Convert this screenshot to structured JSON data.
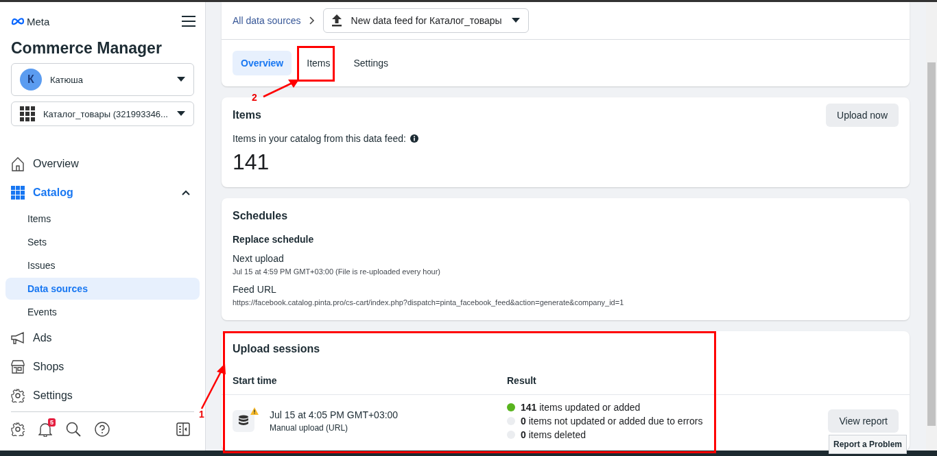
{
  "sidebar": {
    "brand": "Meta",
    "title": "Commerce Manager",
    "account": {
      "initial": "К",
      "name": "Катюша"
    },
    "catalog": "Каталог_товары (321993346...",
    "nav": [
      {
        "label": "Overview",
        "selected": false
      },
      {
        "label": "Catalog",
        "selected": true,
        "expanded": true,
        "children": [
          {
            "label": "Items",
            "selected": false
          },
          {
            "label": "Sets",
            "selected": false
          },
          {
            "label": "Issues",
            "selected": false
          },
          {
            "label": "Data sources",
            "selected": true
          },
          {
            "label": "Events",
            "selected": false
          }
        ]
      },
      {
        "label": "Ads",
        "selected": false
      },
      {
        "label": "Shops",
        "selected": false
      },
      {
        "label": "Settings",
        "selected": false
      }
    ],
    "notification_count": "5"
  },
  "breadcrumb": {
    "link": "All data sources",
    "feed": "New data feed for Каталог_товары"
  },
  "tabs": [
    {
      "label": "Overview",
      "selected": true
    },
    {
      "label": "Items",
      "selected": false
    },
    {
      "label": "Settings",
      "selected": false
    }
  ],
  "items_card": {
    "title": "Items",
    "button": "Upload now",
    "caption": "Items in your catalog from this data feed:",
    "count": "141"
  },
  "schedules": {
    "title": "Schedules",
    "subtitle": "Replace schedule",
    "fields": [
      {
        "label": "Next upload",
        "value": "Jul 15 at 4:59 PM GMT+03:00 (File is re-uploaded every hour)"
      },
      {
        "label": "Feed URL",
        "value": "https://facebook.catalog.pinta.pro/cs-cart/index.php?dispatch=pinta_facebook_feed&action=generate&company_id=1"
      }
    ]
  },
  "upload_sessions": {
    "title": "Upload sessions",
    "columns": [
      "Start time",
      "Result"
    ],
    "rows": [
      {
        "time": "Jul 15 at 4:05 PM GMT+03:00",
        "source": "Manual upload (URL)",
        "warning": true,
        "results": [
          {
            "text": "**141** items updated or added",
            "color": "#58b41e"
          },
          {
            "text": "**0** items not updated or added due to errors",
            "color": "#ebedf0"
          },
          {
            "text": "**0** items deleted",
            "color": "#ebedf0"
          }
        ],
        "button": "View report"
      }
    ]
  },
  "report_button": "Report a Problem",
  "annotations": [
    {
      "label": "2"
    },
    {
      "label": "1"
    }
  ]
}
